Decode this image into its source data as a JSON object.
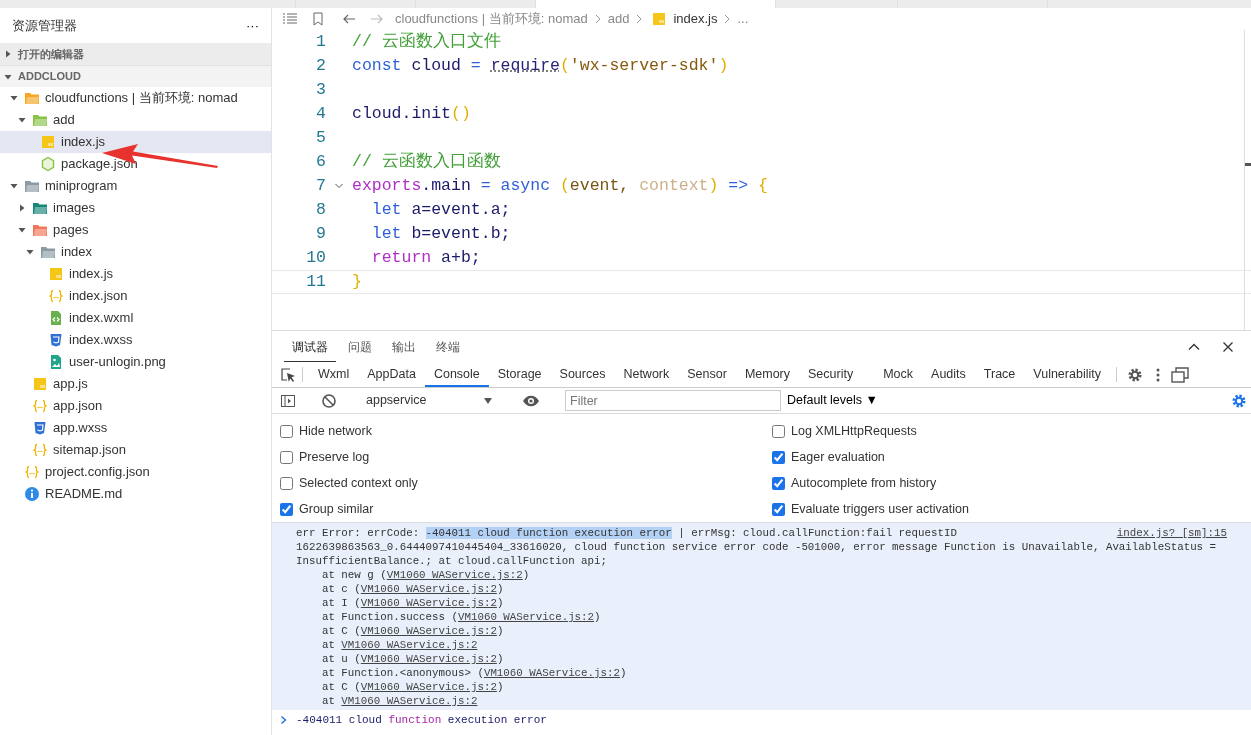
{
  "sidebar": {
    "title": "资源管理器",
    "more": "···",
    "sections": [
      {
        "label": "打开的编辑器",
        "expanded": false
      },
      {
        "label": "ADDCLOUD",
        "expanded": true
      }
    ],
    "tree": [
      {
        "label": "cloudfunctions | 当前环境: nomad",
        "kind": "folder-cloud",
        "expanded": true,
        "selected": false,
        "children": [
          {
            "label": "add",
            "kind": "folder-function",
            "expanded": true,
            "selected": false,
            "children": [
              {
                "label": "index.js",
                "kind": "js",
                "selected": true
              },
              {
                "label": "package.json",
                "kind": "package",
                "selected": false
              }
            ]
          }
        ]
      },
      {
        "label": "miniprogram",
        "kind": "folder",
        "expanded": true,
        "selected": false,
        "children": [
          {
            "label": "images",
            "kind": "folder-images",
            "expanded": false,
            "selected": false
          },
          {
            "label": "pages",
            "kind": "folder-pages",
            "expanded": true,
            "selected": false,
            "children": [
              {
                "label": "index",
                "kind": "folder",
                "expanded": true,
                "selected": false,
                "children": [
                  {
                    "label": "index.js",
                    "kind": "js",
                    "selected": false
                  },
                  {
                    "label": "index.json",
                    "kind": "json",
                    "selected": false
                  },
                  {
                    "label": "index.wxml",
                    "kind": "wxml",
                    "selected": false
                  },
                  {
                    "label": "index.wxss",
                    "kind": "wxss",
                    "selected": false
                  },
                  {
                    "label": "user-unlogin.png",
                    "kind": "image",
                    "selected": false
                  }
                ]
              }
            ]
          },
          {
            "label": "app.js",
            "kind": "js",
            "selected": false
          },
          {
            "label": "app.json",
            "kind": "json",
            "selected": false
          },
          {
            "label": "app.wxss",
            "kind": "wxss",
            "selected": false
          },
          {
            "label": "sitemap.json",
            "kind": "json",
            "selected": false
          }
        ]
      },
      {
        "label": "project.config.json",
        "kind": "json",
        "selected": false
      },
      {
        "label": "README.md",
        "kind": "info",
        "selected": false
      }
    ]
  },
  "editor": {
    "breadcrumb": [
      {
        "label": "cloudfunctions | 当前环境: nomad",
        "kind": "folder"
      },
      {
        "label": "add",
        "kind": "folder"
      },
      {
        "label": "index.js",
        "kind": "js"
      },
      {
        "label": "...",
        "kind": "more"
      }
    ],
    "lines": [
      {
        "number": "1",
        "current": false,
        "tokens": [
          {
            "text": "// 云函数入口文件",
            "kind": "comment"
          }
        ]
      },
      {
        "number": "2",
        "current": false,
        "tokens": [
          {
            "text": "const",
            "kind": "keyword"
          },
          {
            "text": " cloud ",
            "kind": "variable"
          },
          {
            "text": "= ",
            "kind": "keyword"
          },
          {
            "text": "require",
            "kind": "function",
            "hint": true
          },
          {
            "text": "(",
            "kind": "paren"
          },
          {
            "text": "'wx-server-sdk'",
            "kind": "string"
          },
          {
            "text": ")",
            "kind": "paren"
          }
        ]
      },
      {
        "number": "3",
        "current": false
      },
      {
        "number": "4",
        "current": false,
        "tokens": [
          {
            "text": "cloud.init",
            "kind": "variable"
          },
          {
            "text": "()",
            "kind": "paren"
          }
        ]
      },
      {
        "number": "5",
        "current": false
      },
      {
        "number": "6",
        "current": false,
        "tokens": [
          {
            "text": "// 云函数入口函数",
            "kind": "comment"
          }
        ]
      },
      {
        "number": "7",
        "current": false,
        "fold_expanded": true,
        "tokens": [
          {
            "text": "exports",
            "kind": "control"
          },
          {
            "text": ".main ",
            "kind": "variable"
          },
          {
            "text": "=",
            "kind": "keyword"
          },
          {
            "text": " async ",
            "kind": "keyword"
          },
          {
            "text": "(",
            "kind": "paren"
          },
          {
            "text": "event, ",
            "kind": "parameter"
          },
          {
            "text": "context",
            "kind": "unused"
          },
          {
            "text": ")",
            "kind": "paren"
          },
          {
            "text": " => ",
            "kind": "keyword"
          },
          {
            "text": "{",
            "kind": "paren"
          }
        ]
      },
      {
        "number": "8",
        "current": false,
        "tokens": [
          {
            "text": "  let",
            "kind": "keyword"
          },
          {
            "text": " a=event.a;",
            "kind": "variable"
          }
        ]
      },
      {
        "number": "9",
        "current": false,
        "tokens": [
          {
            "text": "  let",
            "kind": "keyword"
          },
          {
            "text": " b=event.b;",
            "kind": "variable"
          }
        ]
      },
      {
        "number": "10",
        "current": false,
        "tokens": [
          {
            "text": "  return",
            "kind": "control"
          },
          {
            "text": " a+b;",
            "kind": "variable"
          }
        ]
      },
      {
        "number": "11",
        "current": true,
        "tokens": [
          {
            "text": "}",
            "kind": "paren"
          }
        ]
      }
    ]
  },
  "panel": {
    "tabs": [
      {
        "label": "调试器",
        "selected": true
      },
      {
        "label": "问题",
        "selected": false
      },
      {
        "label": "输出",
        "selected": false
      },
      {
        "label": "终端",
        "selected": false
      }
    ],
    "devtools_tabs": [
      {
        "label": "Wxml",
        "selected": false
      },
      {
        "label": "AppData",
        "selected": false
      },
      {
        "label": "Console",
        "selected": true
      },
      {
        "label": "Storage",
        "selected": false
      },
      {
        "label": "Sources",
        "selected": false
      },
      {
        "label": "Network",
        "selected": false
      },
      {
        "label": "Sensor",
        "selected": false
      },
      {
        "label": "Memory",
        "selected": false
      },
      {
        "label": "Security",
        "selected": false
      },
      {
        "label": "Mock",
        "selected": false
      },
      {
        "label": "Audits",
        "selected": false
      },
      {
        "label": "Trace",
        "selected": false
      },
      {
        "label": "Vulnerability",
        "selected": false
      }
    ],
    "context": "appservice",
    "filter": {
      "placeholder": "Filter"
    },
    "levels": "Default levels ▼",
    "settings_left": [
      {
        "label": "Hide network",
        "checked": false
      },
      {
        "label": "Preserve log",
        "checked": false
      },
      {
        "label": "Selected context only",
        "checked": false
      },
      {
        "label": "Group similar",
        "checked": true
      }
    ],
    "settings_right": [
      {
        "label": "Log XMLHttpRequests",
        "checked": false
      },
      {
        "label": "Eager evaluation",
        "checked": true
      },
      {
        "label": "Autocomplete from history",
        "checked": true
      },
      {
        "label": "Evaluate triggers user activation",
        "checked": true
      }
    ],
    "message": {
      "source": "index.js? [sm]:15",
      "lines": [
        [
          {
            "text": "err Error: errCode: ",
            "kind": "plain"
          },
          {
            "text": "-404011 cloud function execution error",
            "kind": "highlight"
          },
          {
            "text": " | errMsg: cloud.callFunction:fail requestID",
            "kind": "plain"
          }
        ],
        [
          {
            "text": "1622639863563_0.6444097410445404_33616020, cloud function service error code -501000, error message Function is Unavailable, AvailableStatus =",
            "kind": "plain"
          }
        ],
        [
          {
            "text": "InsufficientBalance.; at cloud.callFunction api;",
            "kind": "plain"
          }
        ],
        [
          {
            "text": "    at new g (",
            "kind": "plain"
          },
          {
            "text": "VM1060 WAService.js:2",
            "kind": "link"
          },
          {
            "text": ")",
            "kind": "plain"
          }
        ],
        [
          {
            "text": "    at c (",
            "kind": "plain"
          },
          {
            "text": "VM1060 WAService.js:2",
            "kind": "link"
          },
          {
            "text": ")",
            "kind": "plain"
          }
        ],
        [
          {
            "text": "    at I (",
            "kind": "plain"
          },
          {
            "text": "VM1060 WAService.js:2",
            "kind": "link"
          },
          {
            "text": ")",
            "kind": "plain"
          }
        ],
        [
          {
            "text": "    at Function.success (",
            "kind": "plain"
          },
          {
            "text": "VM1060 WAService.js:2",
            "kind": "link"
          },
          {
            "text": ")",
            "kind": "plain"
          }
        ],
        [
          {
            "text": "    at C (",
            "kind": "plain"
          },
          {
            "text": "VM1060 WAService.js:2",
            "kind": "link"
          },
          {
            "text": ")",
            "kind": "plain"
          }
        ],
        [
          {
            "text": "    at ",
            "kind": "plain"
          },
          {
            "text": "VM1060 WAService.js:2",
            "kind": "link"
          }
        ],
        [
          {
            "text": "    at u (",
            "kind": "plain"
          },
          {
            "text": "VM1060 WAService.js:2",
            "kind": "link"
          },
          {
            "text": ")",
            "kind": "plain"
          }
        ],
        [
          {
            "text": "    at Function.<anonymous> (",
            "kind": "plain"
          },
          {
            "text": "VM1060 WAService.js:2",
            "kind": "link"
          },
          {
            "text": ")",
            "kind": "plain"
          }
        ],
        [
          {
            "text": "    at C (",
            "kind": "plain"
          },
          {
            "text": "VM1060 WAService.js:2",
            "kind": "link"
          },
          {
            "text": ")",
            "kind": "plain"
          }
        ],
        [
          {
            "text": "    at ",
            "kind": "plain"
          },
          {
            "text": "VM1060 WAService.js:2",
            "kind": "link"
          }
        ]
      ]
    },
    "result": [
      {
        "text": "-404011 cloud ",
        "kind": "plain"
      },
      {
        "text": "function",
        "kind": "keyword"
      },
      {
        "text": " execution error",
        "kind": "plain"
      }
    ]
  }
}
